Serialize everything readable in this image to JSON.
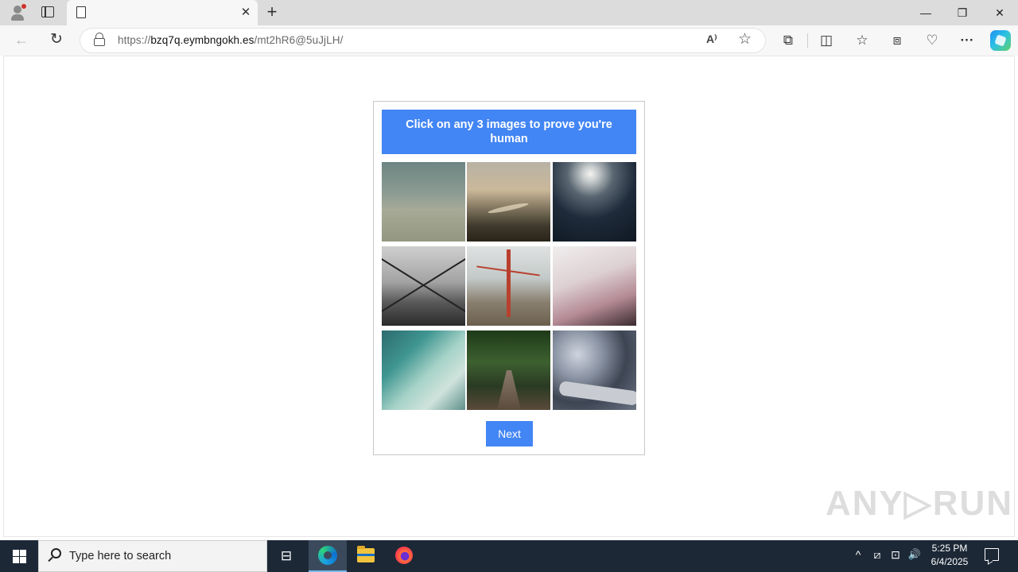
{
  "browser": {
    "tab": {
      "title": "",
      "close_glyph": "✕"
    },
    "new_tab_glyph": "+",
    "window_controls": {
      "minimize": "—",
      "maximize": "❐",
      "close": "✕"
    },
    "nav": {
      "back_glyph": "←",
      "reload_glyph": "↻"
    },
    "address": {
      "protocol": "https://",
      "host": "bzq7q.eymbngokh.es",
      "path": "/mt2hR6@5uJjLH/"
    },
    "toolbar_icons": {
      "read_aloud": "A⁾",
      "favorite": "☆",
      "extensions": "⧉",
      "split_screen": "◫",
      "favorites": "☆",
      "collections": "⧈",
      "browser_essentials": "♡",
      "more": "···"
    }
  },
  "captcha": {
    "header": "Click on any 3 images to prove you're human",
    "images": [
      {
        "name": "misty-mountains",
        "color": "#8c9c93"
      },
      {
        "name": "river-valley-sunset",
        "color": "#8a7e66"
      },
      {
        "name": "ocean-waves-sun",
        "color": "#1f2b3a"
      },
      {
        "name": "city-skyline-window",
        "color": "#5a5a5a"
      },
      {
        "name": "golden-gate-bridge-fog",
        "color": "#b8402e"
      },
      {
        "name": "pink-blossom-branches",
        "color": "#b48a95"
      },
      {
        "name": "green-wave-curl",
        "color": "#3f9591"
      },
      {
        "name": "forest-wooden-bridge",
        "color": "#3d6030"
      },
      {
        "name": "phone-bokeh",
        "color": "#8a93a3"
      }
    ],
    "next_label": "Next",
    "accent": "#4285f4"
  },
  "watermark": "ANY▷RUN",
  "taskbar": {
    "search_placeholder": "Type here to search",
    "task_view_glyph": "⊟",
    "tray": {
      "chevron": "^",
      "meet": "⧄",
      "network": "⊡",
      "volume": "🔊"
    },
    "clock": {
      "time": "5:25 PM",
      "date": "6/4/2025"
    },
    "bg": "#1c2836"
  }
}
